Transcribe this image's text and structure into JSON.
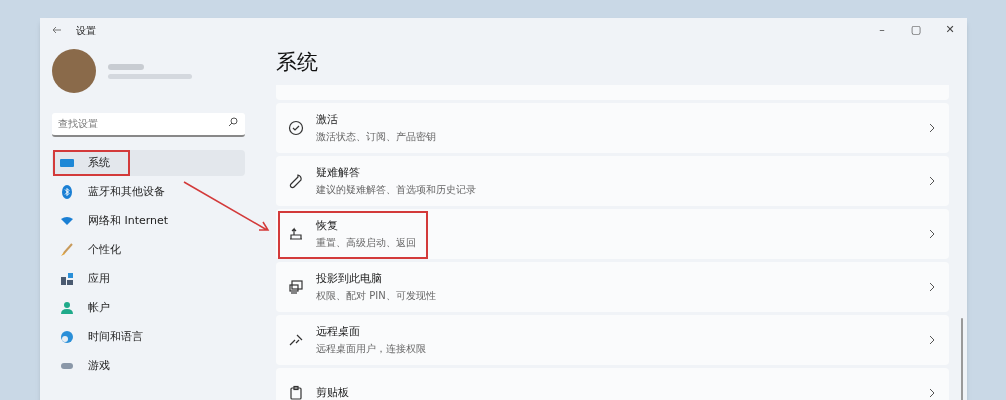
{
  "window": {
    "title": "设置",
    "controls": [
      "–",
      "▢",
      "✕"
    ]
  },
  "search": {
    "placeholder": "查找设置"
  },
  "sidebar": {
    "items": [
      {
        "label": "系统",
        "selected": true,
        "annotated": true
      },
      {
        "label": "蓝牙和其他设备",
        "selected": false,
        "annotated": false
      },
      {
        "label": "网络和 Internet",
        "selected": false,
        "annotated": false
      },
      {
        "label": "个性化",
        "selected": false,
        "annotated": false
      },
      {
        "label": "应用",
        "selected": false,
        "annotated": false
      },
      {
        "label": "帐户",
        "selected": false,
        "annotated": false
      },
      {
        "label": "时间和语言",
        "selected": false,
        "annotated": false
      },
      {
        "label": "游戏",
        "selected": false,
        "annotated": false
      }
    ]
  },
  "page": {
    "title": "系统",
    "cards": [
      {
        "title": "激活",
        "subtitle": "激活状态、订阅、产品密钥",
        "annotated": false
      },
      {
        "title": "疑难解答",
        "subtitle": "建议的疑难解答、首选项和历史记录",
        "annotated": false
      },
      {
        "title": "恢复",
        "subtitle": "重置、高级启动、返回",
        "annotated": true
      },
      {
        "title": "投影到此电脑",
        "subtitle": "权限、配对 PIN、可发现性",
        "annotated": false
      },
      {
        "title": "远程桌面",
        "subtitle": "远程桌面用户，连接权限",
        "annotated": false
      },
      {
        "title": "剪贴板",
        "annotated": false
      }
    ]
  }
}
